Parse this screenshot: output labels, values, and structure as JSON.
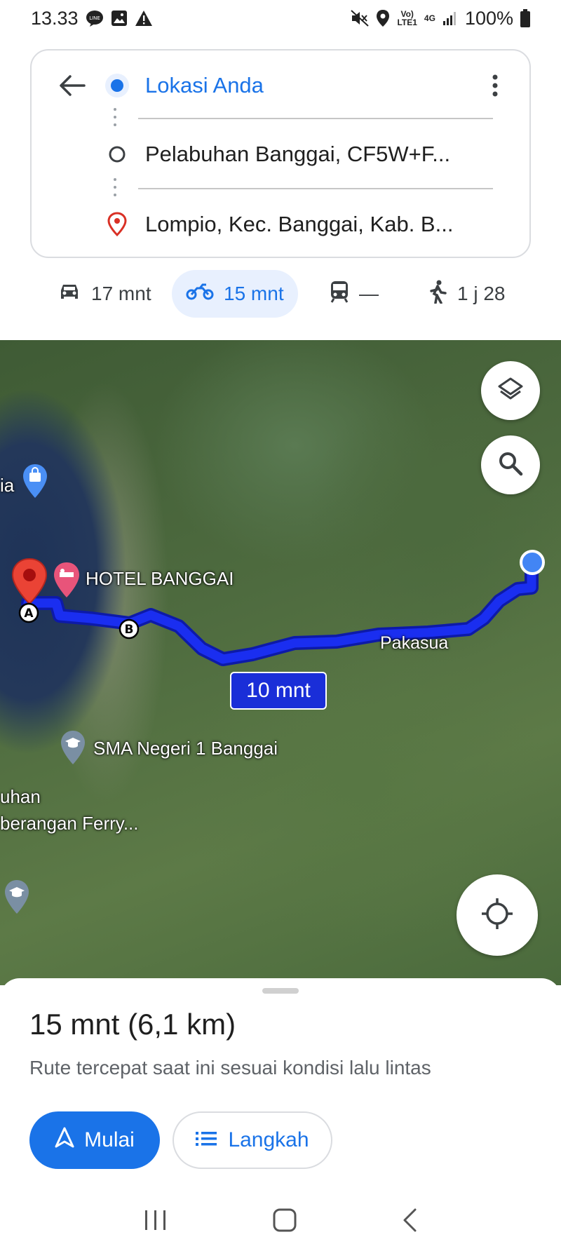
{
  "status_bar": {
    "time": "13.33",
    "signal_label_top": "Vo)",
    "signal_label_bottom": "LTE1",
    "network": "4G",
    "battery": "100%",
    "icons": [
      "line-icon",
      "gallery-icon",
      "warning-icon",
      "mute-icon",
      "location-icon",
      "signal-icon",
      "battery-icon"
    ]
  },
  "route": {
    "origin": "Lokasi Anda",
    "stop": "Pelabuhan Banggai, CF5W+F...",
    "destination": "Lompio, Kec. Banggai, Kab. B..."
  },
  "modes": [
    {
      "name": "car",
      "label": "17 mnt",
      "active": false
    },
    {
      "name": "motorcycle",
      "label": "15 mnt",
      "active": true
    },
    {
      "name": "transit",
      "label": "—",
      "active": false
    },
    {
      "name": "walk",
      "label": "1 j 28",
      "active": false
    }
  ],
  "map": {
    "labels": {
      "hotel": "HOTEL BANGGAI",
      "pakasua": "Pakasua",
      "sma": "SMA Negeri 1 Banggai",
      "ferry_line1": "uhan",
      "ferry_line2": "berangan Ferry...",
      "ia": "ia"
    },
    "eta_badge": "10 mnt",
    "waypoint_a": "A",
    "waypoint_b": "B",
    "route_color": "#1a2ef0"
  },
  "sheet": {
    "summary": "15 mnt (6,1 km)",
    "description": "Rute tercepat saat ini sesuai kondisi lalu lintas",
    "start_label": "Mulai",
    "steps_label": "Langkah"
  },
  "colors": {
    "accent": "#1a73e8",
    "active_tab_bg": "#e8f0fe",
    "destination_pin": "#d93025"
  }
}
